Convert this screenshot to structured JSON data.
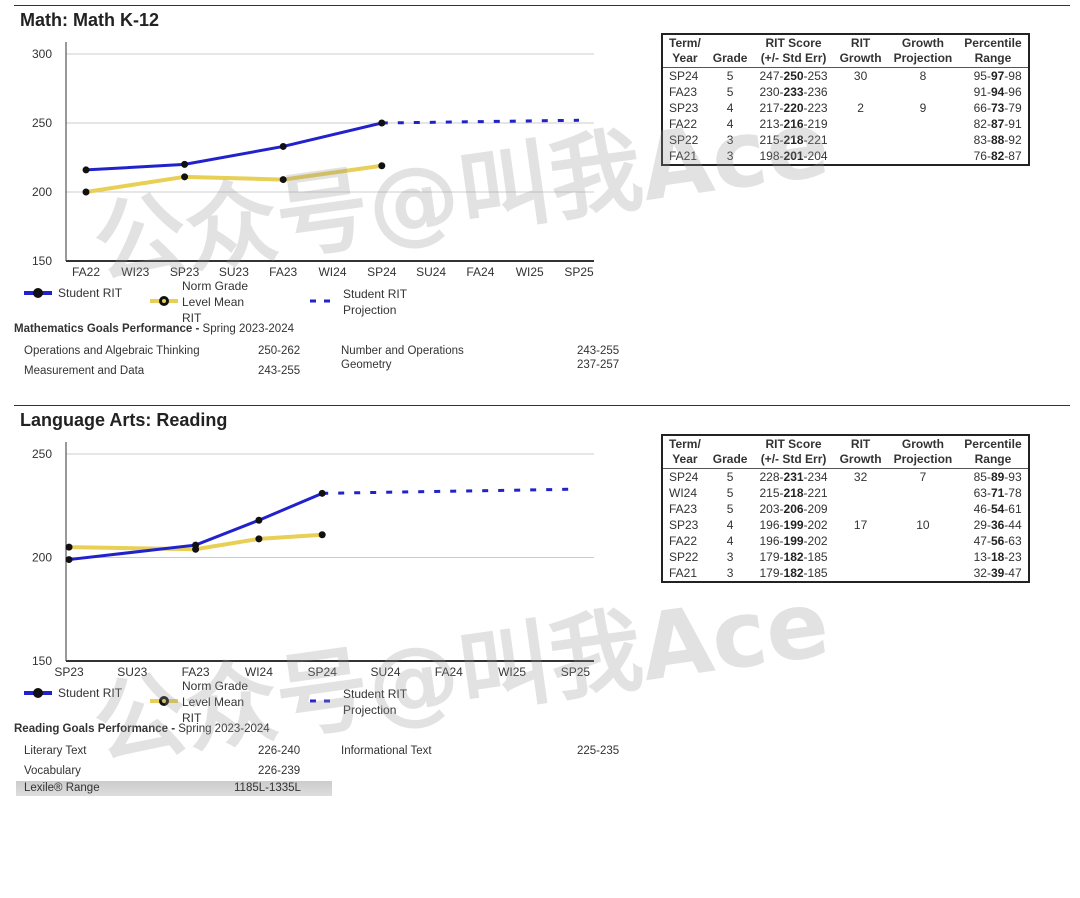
{
  "watermark": "公众号@叫我Ace",
  "colors": {
    "student": "#2222cc",
    "norm": "#e8cf55",
    "projection": "#2222cc",
    "point": "#111111"
  },
  "legend": {
    "student": "Student RIT",
    "norm": "Norm Grade Level Mean RIT",
    "projection": "Student RIT Projection"
  },
  "table_headers": [
    "Term/ Year",
    "Grade",
    "RIT Score (+/- Std Err)",
    "RIT Growth",
    "Growth Projection",
    "Percentile Range"
  ],
  "math": {
    "title": "Math: Math K-12",
    "goals_title": "Mathematics Goals Performance - ",
    "goals_term": "Spring 2023-2024",
    "goals": [
      [
        "Operations and Algebraic Thinking",
        "250-262"
      ],
      [
        "Number and Operations",
        "243-255"
      ],
      [
        "Measurement and Data",
        "243-255"
      ],
      [
        "Geometry",
        "237-257"
      ]
    ],
    "rows": [
      [
        "SP24",
        "5",
        "247",
        "250",
        "253",
        "30",
        "8",
        "95",
        "97",
        "98"
      ],
      [
        "FA23",
        "5",
        "230",
        "233",
        "236",
        "",
        "",
        "91",
        "94",
        "96"
      ],
      [
        "SP23",
        "4",
        "217",
        "220",
        "223",
        "2",
        "9",
        "66",
        "73",
        "79"
      ],
      [
        "FA22",
        "4",
        "213",
        "216",
        "219",
        "",
        "",
        "82",
        "87",
        "91"
      ],
      [
        "SP22",
        "3",
        "215",
        "218",
        "221",
        "",
        "",
        "83",
        "88",
        "92"
      ],
      [
        "FA21",
        "3",
        "198",
        "201",
        "204",
        "",
        "",
        "76",
        "82",
        "87"
      ]
    ]
  },
  "reading": {
    "title": "Language Arts: Reading",
    "goals_title": "Reading Goals Performance - ",
    "goals_term": "Spring 2023-2024",
    "goals": [
      [
        "Literary Text",
        "226-240"
      ],
      [
        "Informational Text",
        "225-235"
      ],
      [
        "Vocabulary",
        "226-239"
      ]
    ],
    "lexile_label": "Lexile® Range",
    "lexile_value": "1185L-1335L",
    "rows": [
      [
        "SP24",
        "5",
        "228",
        "231",
        "234",
        "32",
        "7",
        "85",
        "89",
        "93"
      ],
      [
        "WI24",
        "5",
        "215",
        "218",
        "221",
        "",
        "",
        "63",
        "71",
        "78"
      ],
      [
        "FA23",
        "5",
        "203",
        "206",
        "209",
        "",
        "",
        "46",
        "54",
        "61"
      ],
      [
        "SP23",
        "4",
        "196",
        "199",
        "202",
        "17",
        "10",
        "29",
        "36",
        "44"
      ],
      [
        "FA22",
        "4",
        "196",
        "199",
        "202",
        "",
        "",
        "47",
        "56",
        "63"
      ],
      [
        "SP22",
        "3",
        "179",
        "182",
        "185",
        "",
        "",
        "13",
        "18",
        "23"
      ],
      [
        "FA21",
        "3",
        "179",
        "182",
        "185",
        "",
        "",
        "32",
        "39",
        "47"
      ]
    ]
  },
  "chart_data": [
    {
      "type": "line",
      "title": "Math: Math K-12",
      "categories": [
        "FA22",
        "WI23",
        "SP23",
        "SU23",
        "FA23",
        "WI24",
        "SP24",
        "SU24",
        "FA24",
        "WI25",
        "SP25"
      ],
      "ylim": [
        150,
        300
      ],
      "yticks": [
        150,
        200,
        250,
        300
      ],
      "grid": true,
      "legend": "bottom",
      "series": [
        {
          "name": "Student RIT",
          "points": [
            [
              "FA22",
              216
            ],
            [
              "SP23",
              220
            ],
            [
              "FA23",
              233
            ],
            [
              "SP24",
              250
            ]
          ]
        },
        {
          "name": "Norm Grade Level Mean RIT",
          "points": [
            [
              "FA22",
              200
            ],
            [
              "SP23",
              211
            ],
            [
              "FA23",
              209
            ],
            [
              "SP24",
              219
            ]
          ]
        },
        {
          "name": "Student RIT Projection",
          "points": [
            [
              "SP24",
              250
            ],
            [
              "SP25",
              252
            ]
          ]
        }
      ]
    },
    {
      "type": "line",
      "title": "Language Arts: Reading",
      "categories": [
        "SP23",
        "SU23",
        "FA23",
        "WI24",
        "SP24",
        "SU24",
        "FA24",
        "WI25",
        "SP25"
      ],
      "ylim": [
        150,
        250
      ],
      "yticks": [
        150,
        200,
        250
      ],
      "grid": true,
      "legend": "bottom",
      "series": [
        {
          "name": "Student RIT",
          "points": [
            [
              "SP23",
              199
            ],
            [
              "FA23",
              206
            ],
            [
              "WI24",
              218
            ],
            [
              "SP24",
              231
            ]
          ]
        },
        {
          "name": "Norm Grade Level Mean RIT",
          "points": [
            [
              "SP23",
              205
            ],
            [
              "FA23",
              204
            ],
            [
              "WI24",
              209
            ],
            [
              "SP24",
              211
            ]
          ]
        },
        {
          "name": "Student RIT Projection",
          "points": [
            [
              "SP24",
              231
            ],
            [
              "SP25",
              233
            ]
          ]
        }
      ]
    }
  ]
}
